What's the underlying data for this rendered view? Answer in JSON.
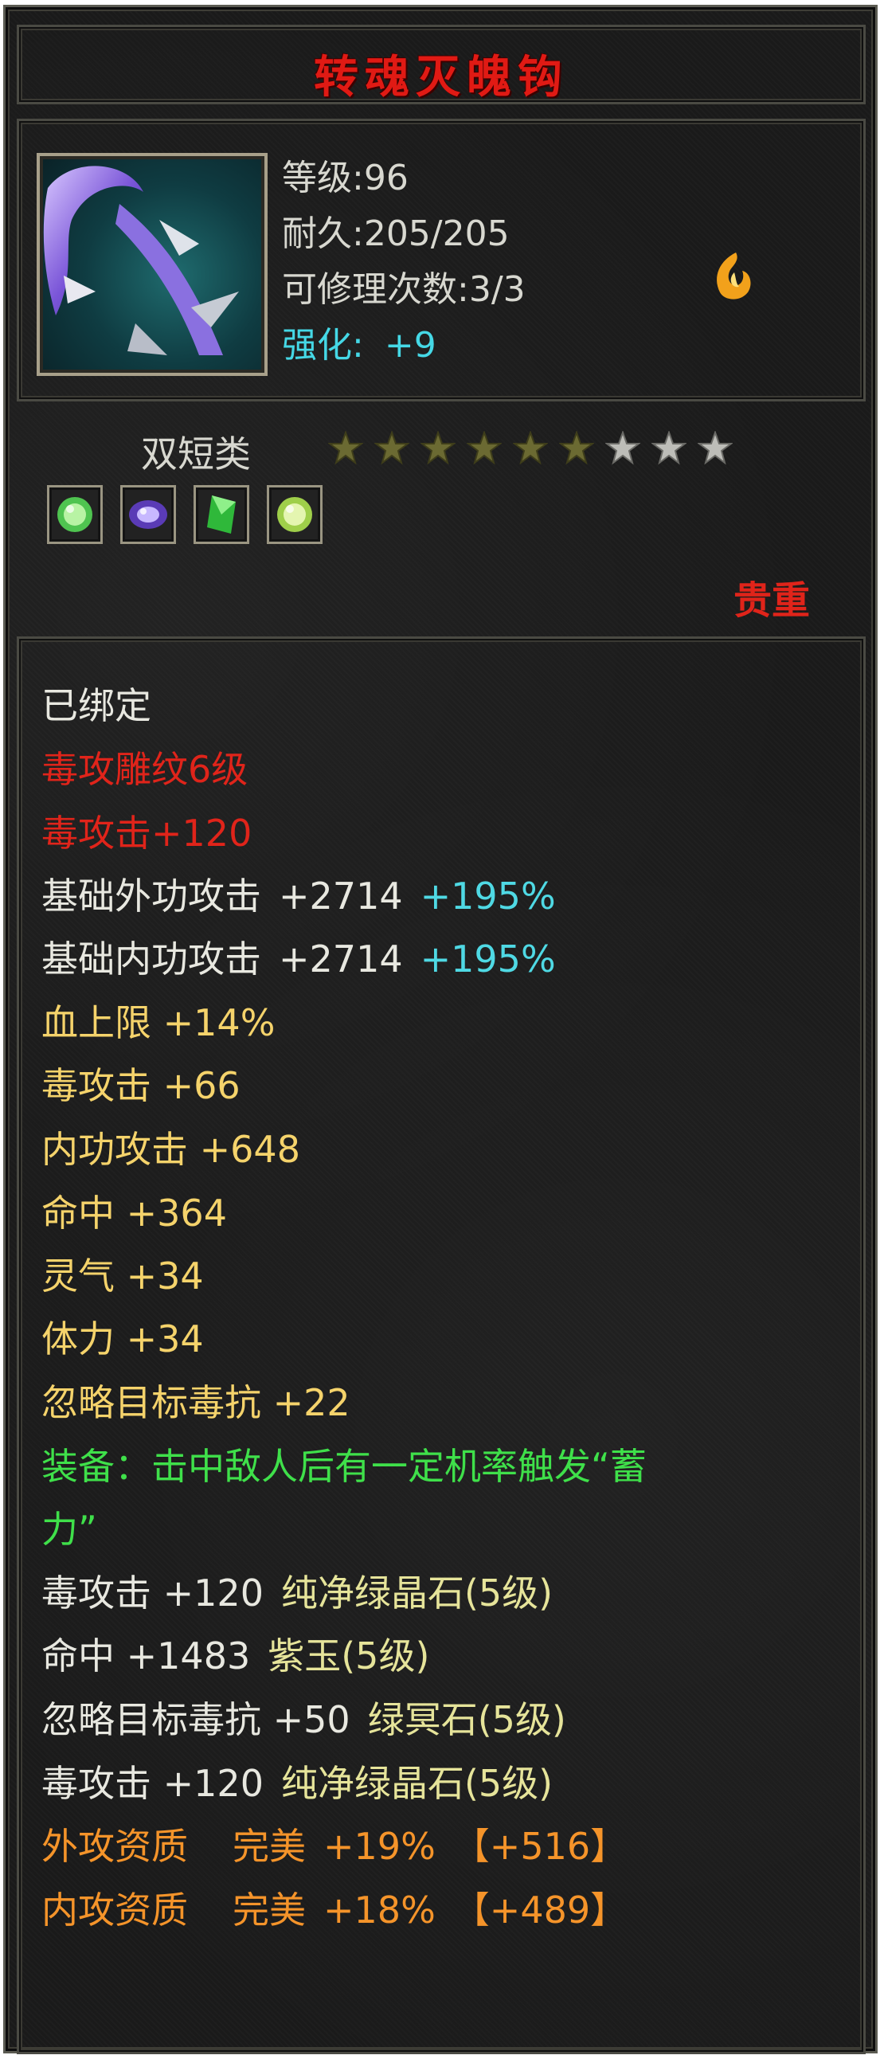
{
  "item": {
    "name": "转魂灭魄钩",
    "level_label": "等级:96",
    "durability_label": "耐久:205/205",
    "repair_label": "可修理次数:3/3",
    "enhance_label": "强化:",
    "enhance_value": "+9",
    "type_label": "双短类",
    "stars_total": 9,
    "stars_filled": 6,
    "rarity": "贵重",
    "quality_icon": "flame-emblem-icon",
    "gems": [
      "green-gem-icon",
      "purple-gem-icon",
      "green-crystal-icon",
      "yellow-green-gem-icon"
    ]
  },
  "properties": {
    "bound": "已绑定",
    "carving": "毒攻雕纹6级",
    "carving_bonus": "毒攻击+120",
    "ext_attack": {
      "label": "基础外功攻击",
      "value": "+2714",
      "pct": "+195%"
    },
    "int_attack": {
      "label": "基础内功攻击",
      "value": "+2714",
      "pct": "+195%"
    },
    "stats": [
      "血上限 +14%",
      "毒攻击 +66",
      "内功攻击 +648",
      "命中 +364",
      "灵气 +34",
      "体力 +34",
      "忽略目标毒抗 +22"
    ],
    "equip_effect_1": "装备：击中敌人后有一定机率触发“蓄",
    "equip_effect_2": "力”",
    "gem_lines": [
      {
        "stat": "毒攻击 +120",
        "gem": "纯净绿晶石(5级)"
      },
      {
        "stat": "命中 +1483",
        "gem": "紫玉(5级)"
      },
      {
        "stat": "忽略目标毒抗 +50",
        "gem": "绿冥石(5级)"
      },
      {
        "stat": "毒攻击 +120",
        "gem": "纯净绿晶石(5级)"
      }
    ],
    "aptitude": [
      {
        "label": "外攻资质",
        "grade": "完美",
        "pct": "+19%",
        "bonus": "【+516】"
      },
      {
        "label": "内攻资质",
        "grade": "完美",
        "pct": "+18%",
        "bonus": "【+489】"
      }
    ]
  },
  "colors": {
    "title": "#e01a14",
    "stat": "#f5d36b",
    "effect": "#3fe04a",
    "percent": "#4fd9e4",
    "aptitude": "#f5942a"
  }
}
